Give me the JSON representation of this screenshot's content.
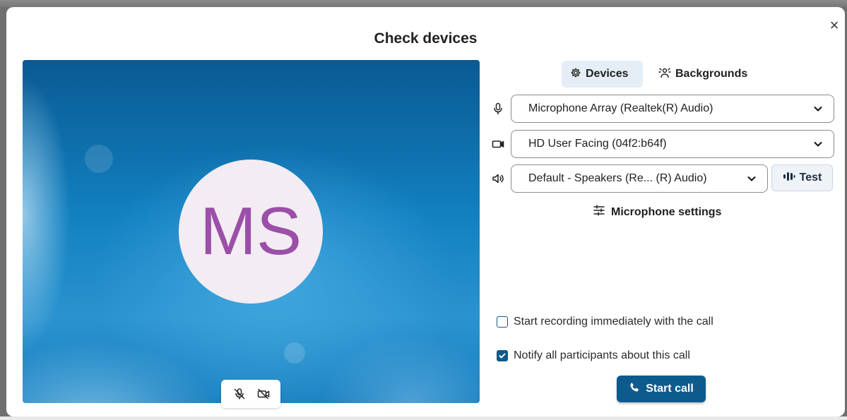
{
  "dialog": {
    "title": "Check devices",
    "close_icon": "×"
  },
  "video": {
    "initials": "MS"
  },
  "tabs": [
    {
      "label": "Devices",
      "icon": "gear-icon",
      "active": true
    },
    {
      "label": "Backgrounds",
      "icon": "backgrounds-icon",
      "active": false
    }
  ],
  "devices": {
    "microphone": "Microphone Array (Realtek(R) Audio)",
    "camera": "HD User Facing (04f2:b64f)",
    "speaker": "Default - Speakers (Re... (R) Audio)",
    "test_label": "Test",
    "mic_settings_label": "Microphone settings"
  },
  "options": {
    "record_label": "Start recording immediately with the call",
    "record_checked": false,
    "notify_label": "Notify all participants about this call",
    "notify_checked": true
  },
  "start_call_label": "Start call",
  "colors": {
    "accent": "#0d5b8c",
    "avatar_text": "#9b4fa8",
    "tab_active_bg": "#e5eef6"
  }
}
